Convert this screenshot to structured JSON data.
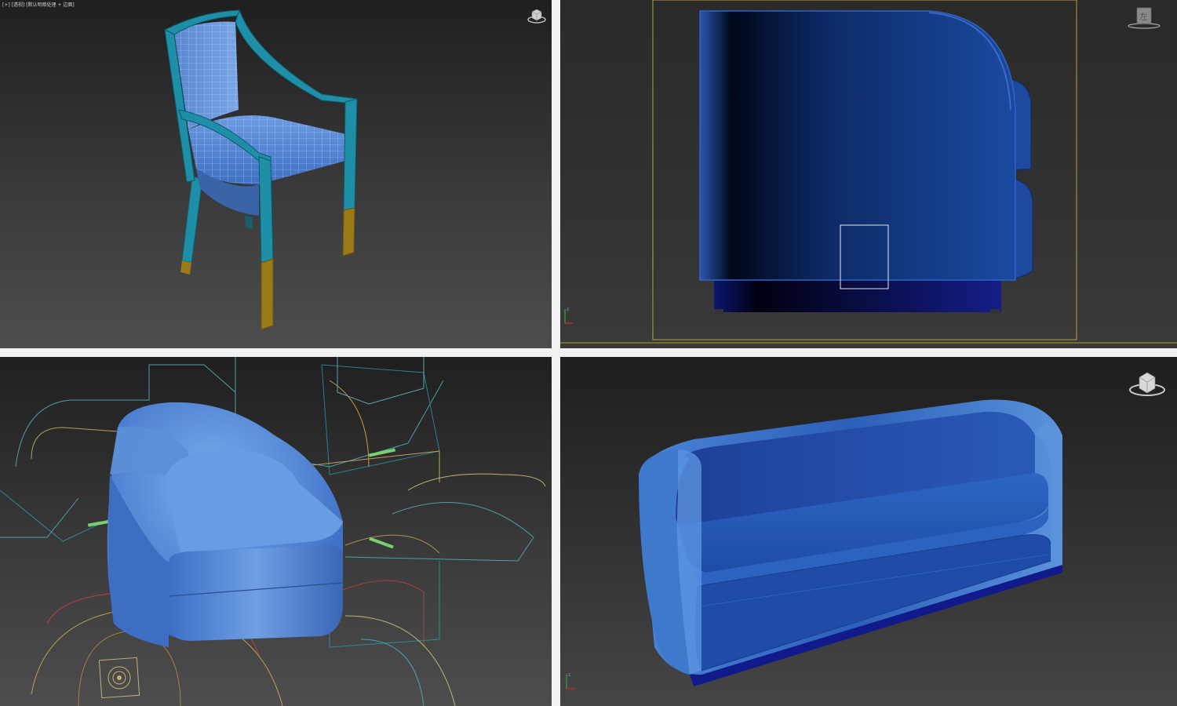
{
  "viewports": {
    "top_left": {
      "label": "[+] [透视] [默认明暗处理 + 边面]",
      "object": "chair-wireframe",
      "viewcube_icon": "viewcube-icon"
    },
    "top_right": {
      "label": "",
      "object": "armchair-side-view",
      "viewcube_icon": "viewcube-icon",
      "viewcube_face_label": "左"
    },
    "bottom_left": {
      "label": "",
      "object": "tub-chair-with-splines",
      "viewcube_icon": "viewcube-icon"
    },
    "bottom_right": {
      "label": "",
      "object": "sofa",
      "viewcube_icon": "viewcube-icon"
    }
  },
  "colors": {
    "viewport_background": "#2b2b2b",
    "model_blue": "#2e62b8",
    "model_light_blue": "#5a8fd6",
    "frame_teal": "#1f8fa8",
    "gold_feet": "#9a7a18",
    "safe_frame_yellow": "#b8a23a",
    "separator": "#f2f2f2"
  }
}
